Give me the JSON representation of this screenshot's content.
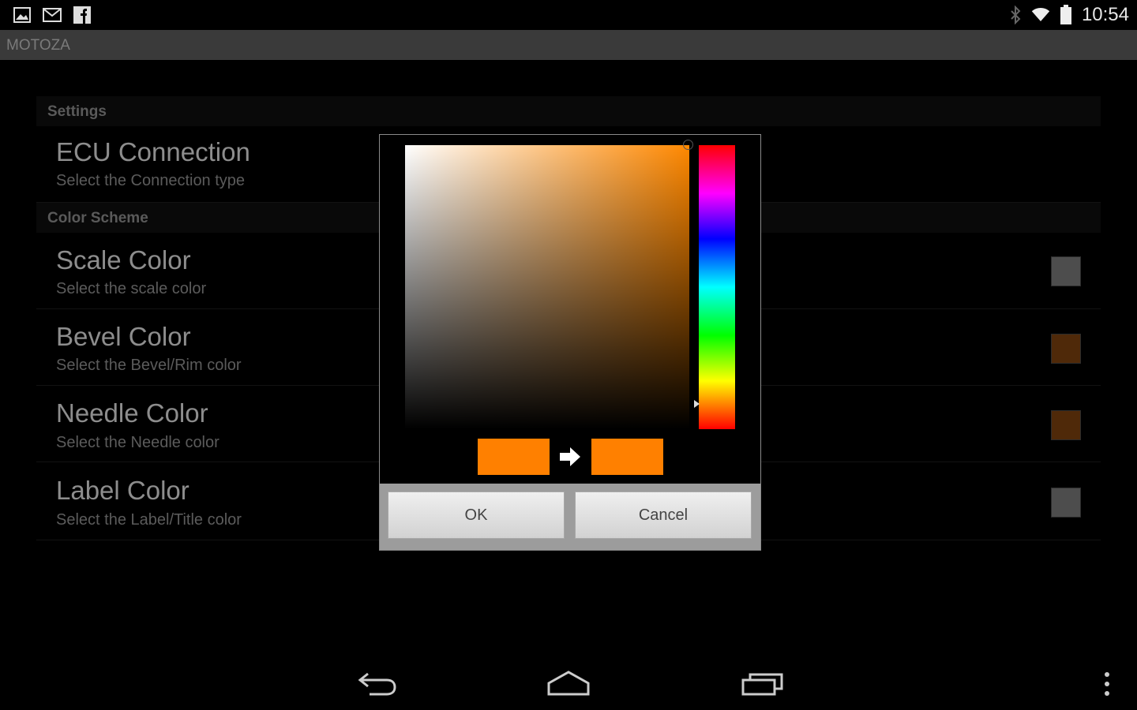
{
  "status_bar": {
    "time": "10:54",
    "notification_icons": [
      "image-icon",
      "gmail-icon",
      "facebook-icon"
    ],
    "system_icons": [
      "bluetooth-icon",
      "wifi-icon",
      "battery-icon"
    ]
  },
  "action_bar": {
    "title": "MOTOZA"
  },
  "settings": {
    "section_settings": "Settings",
    "ecu": {
      "title": "ECU Connection",
      "summary": "Select the Connection type"
    },
    "section_color_scheme": "Color Scheme",
    "items": [
      {
        "title": "Scale Color",
        "summary": "Select the scale color",
        "swatch_color": "#777777"
      },
      {
        "title": "Bevel Color",
        "summary": "Select the Bevel/Rim color",
        "swatch_color": "#7a3f0f"
      },
      {
        "title": "Needle Color",
        "summary": "Select the Needle color",
        "swatch_color": "#7a3f0f"
      },
      {
        "title": "Label Color",
        "summary": "Select the Label/Title color",
        "swatch_color": "#777777"
      }
    ]
  },
  "color_picker": {
    "hue_color": "#ff8800",
    "old_color": "#ff8000",
    "new_color": "#ff8000",
    "ok_label": "OK",
    "cancel_label": "Cancel"
  },
  "nav_bar": {
    "icons": [
      "back-icon",
      "home-icon",
      "recent-apps-icon",
      "overflow-menu-icon"
    ]
  }
}
